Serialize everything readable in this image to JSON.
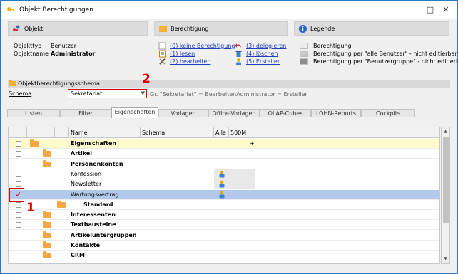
{
  "window": {
    "title": "Objekt Berechtigungen",
    "close_glyph": "✕",
    "max_glyph": "□"
  },
  "objekt": {
    "header": "Objekt",
    "typ_label": "Objekttyp",
    "typ_value": "Benutzer",
    "name_label": "Objektname",
    "name_value": "Administrator"
  },
  "berechtigung": {
    "header": "Berechtigung",
    "items": [
      {
        "label": "(0) keine Berechtigung"
      },
      {
        "label": "(1) lesen"
      },
      {
        "label": "(2) bearbeiten"
      },
      {
        "label": "(3) delegieren"
      },
      {
        "label": "(4) löschen"
      },
      {
        "label": "(5) Ersteller"
      }
    ]
  },
  "legende": {
    "header": "Legende",
    "items": [
      {
        "label": "Berechtigung",
        "color": "#ececec"
      },
      {
        "label": "Berechtigung per \"alle Benutzer\" - nicht editierbar",
        "color": "#c8c8c8"
      },
      {
        "label": "Berechtigung per \"Benutzergruppe\" - nicht editierbar",
        "color": "#8e8e8e"
      }
    ]
  },
  "schema": {
    "section_header": "Objektberechtigungsschema",
    "label": "Schema",
    "value": "Sekretariat",
    "hint": "Gr. \"Sekretariat\" = BearbeitenAdministrator = Ersteller"
  },
  "annotations": {
    "one": "1",
    "two": "2"
  },
  "tabs": [
    {
      "label": "Listen"
    },
    {
      "label": "Filter"
    },
    {
      "label": "Eigenschaften"
    },
    {
      "label": "Vorlagen"
    },
    {
      "label": "Office-Vorlagen"
    },
    {
      "label": "OLAP-Cubes"
    },
    {
      "label": "LOHN-Reports"
    },
    {
      "label": "Cockpits"
    }
  ],
  "grid": {
    "columns": {
      "name": "Name",
      "schema": "Schema",
      "alle": "Alle",
      "m500": "500M"
    },
    "rows": [
      {
        "name": "Eigenschaften",
        "bold": true,
        "plus": "+"
      },
      {
        "name": "Artikel",
        "bold": true
      },
      {
        "name": "Personenkonten",
        "bold": true
      },
      {
        "name": "Konfession",
        "bold": false
      },
      {
        "name": "Newsletter",
        "bold": false
      },
      {
        "name": "Wartungsvertrag",
        "bold": false,
        "checked": true
      },
      {
        "name": "Standard",
        "bold": true
      },
      {
        "name": "Interessenten",
        "bold": true
      },
      {
        "name": "Textbausteine",
        "bold": true
      },
      {
        "name": "Artikeluntergruppen",
        "bold": true
      },
      {
        "name": "Kontakte",
        "bold": true
      },
      {
        "name": "CRM",
        "bold": true
      }
    ]
  },
  "check_glyph": "✓",
  "colors": {
    "accent_red": "#d00000",
    "selected_row": "#b3c9ec",
    "highlight_row": "#fffbcc",
    "folder": "#f7a644"
  }
}
